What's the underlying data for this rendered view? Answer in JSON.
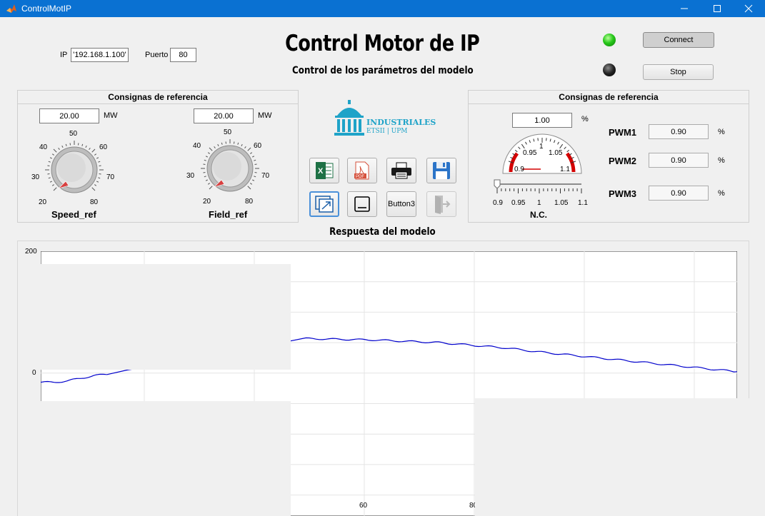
{
  "window": {
    "title": "ControlMotIP"
  },
  "connection": {
    "ip_label": "IP",
    "ip_value": "'192.168.1.100'",
    "port_label": "Puerto",
    "port_value": "80"
  },
  "header": {
    "title": "Control Motor de IP",
    "subtitle": "Control de los parámetros del modelo"
  },
  "controls": {
    "connect_label": "Connect",
    "stop_label": "Stop"
  },
  "left_panel": {
    "title": "Consignas de referencia",
    "speed": {
      "value": "20.00",
      "unit": "MW",
      "label": "Speed_ref",
      "ticks": [
        "20",
        "30",
        "40",
        "50",
        "60",
        "70",
        "80"
      ]
    },
    "field": {
      "value": "20.00",
      "unit": "MW",
      "label": "Field_ref",
      "ticks": [
        "20",
        "30",
        "40",
        "50",
        "60",
        "70",
        "80"
      ]
    }
  },
  "logo": {
    "name": "INDUSTRIALES",
    "sub": "ETSII | UPM"
  },
  "toolbar": {
    "button3_label": "Button3"
  },
  "right_panel": {
    "title": "Consignas de referencia",
    "gauge_value": "1.00",
    "gauge_unit": "%",
    "gauge_ticks": [
      "0.9",
      "0.95",
      "1",
      "1.05",
      "1.1"
    ],
    "slider_ticks": [
      "0.9",
      "0.95",
      "1",
      "1.05",
      "1.1"
    ],
    "slider_value": 0.9,
    "slider_label": "N.C.",
    "pwm": [
      {
        "label": "PWM1",
        "value": "0.90",
        "unit": "%"
      },
      {
        "label": "PWM2",
        "value": "0.90",
        "unit": "%"
      },
      {
        "label": "PWM3",
        "value": "0.90",
        "unit": "%"
      }
    ]
  },
  "chart_section": {
    "title": "Respuesta del modelo"
  },
  "chart_data": {
    "type": "line",
    "ylim": [
      -200,
      200
    ],
    "y_ticks": [
      "200",
      "0"
    ],
    "x_ticks": [
      "60",
      "80"
    ],
    "xlim": [
      0,
      105
    ],
    "grid": true,
    "series": [
      {
        "color": "#0000cc",
        "x": [
          0,
          2,
          4,
          6,
          8,
          10,
          40,
          45,
          50,
          55,
          60,
          65,
          70,
          75,
          80,
          85,
          90,
          95,
          100,
          105
        ],
        "y": [
          2,
          2,
          4,
          8,
          12,
          14,
          68,
          67,
          66,
          64,
          62,
          58,
          54,
          48,
          43,
          38,
          33,
          28,
          23,
          18
        ]
      }
    ]
  },
  "colors": {
    "titlebar": "#0a71d2",
    "led_on": "#27c81a",
    "led_off": "#111111",
    "gauge_red": "#d40000"
  }
}
